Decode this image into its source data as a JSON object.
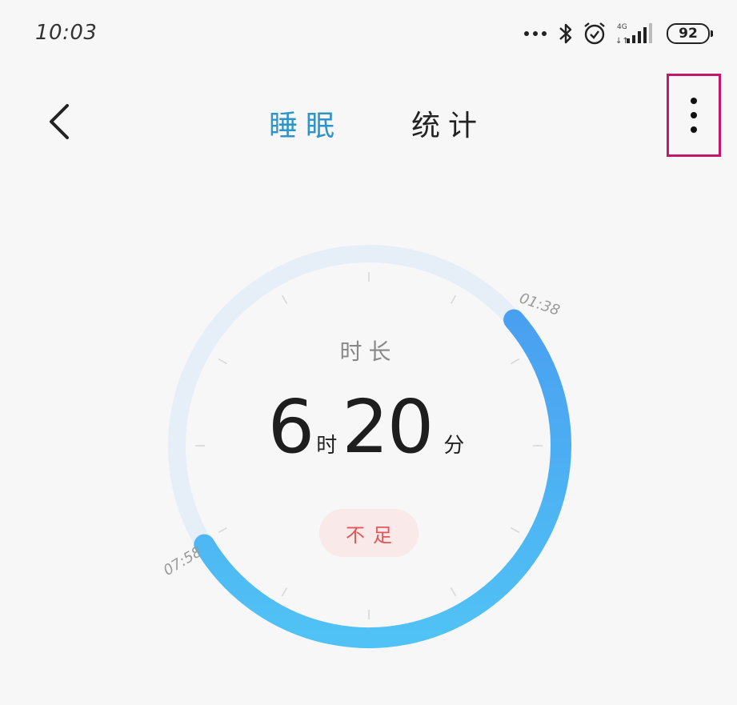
{
  "status_bar": {
    "time": "10:03",
    "network": "4G",
    "battery": "92",
    "icons": [
      "more-dots-icon",
      "bluetooth-icon",
      "alarm-icon",
      "signal-icon",
      "battery-icon"
    ]
  },
  "header": {
    "tabs": [
      {
        "label": "睡眠",
        "active": true
      },
      {
        "label": "统计",
        "active": false
      }
    ],
    "active_color": "#2f94c7",
    "highlight_color": "#c2186b"
  },
  "sleep_dial": {
    "start_time": "01:38",
    "end_time": "07:58",
    "label": "时长",
    "hours": "6",
    "hours_unit": "时",
    "minutes": "20",
    "minutes_unit": "分",
    "status": "不足",
    "track_color": "#e6eef8",
    "arc_colors": [
      "#4aa0f0",
      "#50c2f5"
    ],
    "status_color": "#e2585a"
  }
}
